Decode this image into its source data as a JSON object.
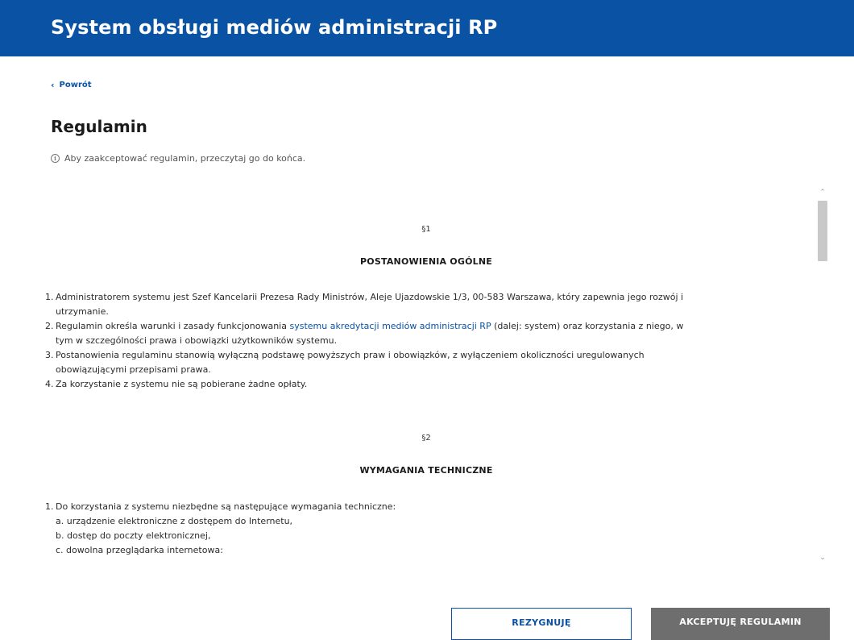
{
  "header": {
    "title": "System obsługi mediów administracji RP"
  },
  "nav": {
    "back_label": "Powrót",
    "back_icon": "chevron-left-icon"
  },
  "page": {
    "title": "Regulamin",
    "info_text": "Aby zaakceptować regulamin, przeczytaj go do końca.",
    "info_icon": "info-icon"
  },
  "terms": {
    "sections": [
      {
        "number": "§1",
        "title": "POSTANOWIENIA OGÓLNE",
        "items": [
          {
            "n": "1.",
            "lines": [
              "Administratorem systemu jest Szef Kancelarii Prezesa Rady Ministrów, Aleje Ujazdowskie 1/3, 00-583 Warszawa, który zapewnia jego rozwój i",
              "utrzymanie."
            ]
          },
          {
            "n": "2.",
            "before": "Regulamin określa warunki i zasady funkcjonowania ",
            "link": "systemu akredytacji mediów administracji RP",
            "after": " (dalej: system) oraz korzystania z niego, w",
            "line2": "tym w szczególności prawa i obowiązki użytkowników systemu."
          },
          {
            "n": "3.",
            "lines": [
              "Postanowienia regulaminu stanowią wyłączną podstawę powyższych praw i obowiązków, z wyłączeniem okoliczności uregulowanych",
              "obowiązującymi przepisami prawa."
            ]
          },
          {
            "n": "4.",
            "lines": [
              "Za korzystanie z systemu nie są pobierane żadne opłaty."
            ]
          }
        ]
      },
      {
        "number": "§2",
        "title": "WYMAGANIA TECHNICZNE",
        "items": [
          {
            "n": "1.",
            "lines": [
              "Do korzystania z systemu niezbędne są następujące wymagania techniczne:"
            ]
          }
        ],
        "subitems": [
          "a. urządzenie elektroniczne z dostępem do Internetu,",
          "b. dostęp do poczty elektronicznej,",
          "c. dowolna przeglądarka internetowa:"
        ]
      }
    ]
  },
  "scrollbar": {
    "up_icon": "chevron-up-icon",
    "down_icon": "chevron-down-icon",
    "up_glyph": "⌃",
    "down_glyph": "⌄"
  },
  "actions": {
    "cancel_label": "REZYGNUJĘ",
    "accept_label": "AKCEPTUJĘ REGULAMIN"
  },
  "colors": {
    "brand": "#0a52a3",
    "accept_disabled": "#6e6e6e"
  }
}
